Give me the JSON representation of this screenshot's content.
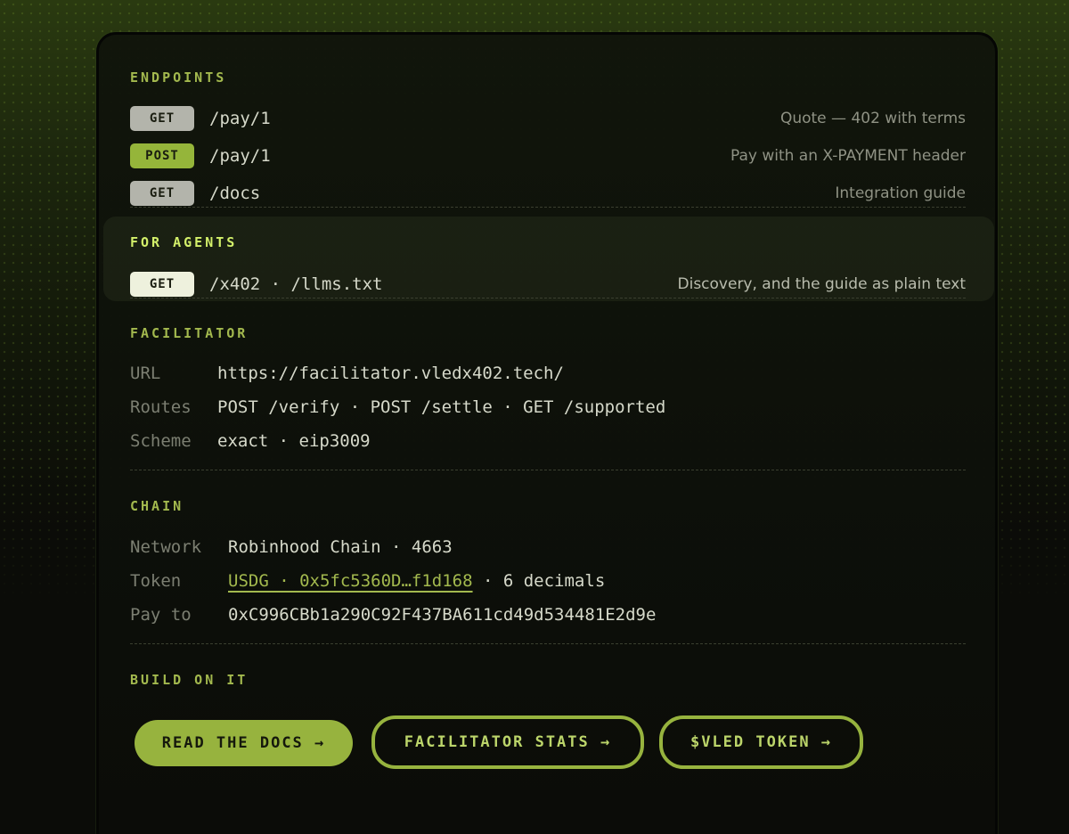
{
  "colors": {
    "accent": "#97b33e",
    "accent_bright": "#d3f06a",
    "background": "#0b0c08",
    "get_badge": "#b3b4ab",
    "post_badge": "#95b53a"
  },
  "endpoints": {
    "title": "ENDPOINTS",
    "rows": [
      {
        "method": "GET",
        "path": "/pay/1",
        "description": "Quote — 402 with terms"
      },
      {
        "method": "POST",
        "path": "/pay/1",
        "description": "Pay with an X-PAYMENT header"
      },
      {
        "method": "GET",
        "path": "/docs",
        "description": "Integration guide"
      }
    ]
  },
  "agents": {
    "title": "FOR AGENTS",
    "row": {
      "method": "GET",
      "path": "/x402 · /llms.txt",
      "description": "Discovery, and the guide as plain text"
    }
  },
  "facilitator": {
    "title": "FACILITATOR",
    "rows": [
      {
        "key": "URL",
        "value": "https://facilitator.vledx402.tech/"
      },
      {
        "key": "Routes",
        "value": "POST /verify · POST /settle · GET /supported"
      },
      {
        "key": "Scheme",
        "value": "exact · eip3009"
      }
    ]
  },
  "chain": {
    "title": "CHAIN",
    "network_key": "Network",
    "network_value": "Robinhood Chain · 4663",
    "token_key": "Token",
    "token_link": "USDG · 0x5fc5360D…f1d168",
    "token_suffix": " · 6 decimals",
    "payto_key": "Pay to",
    "payto_value": "0xC996CBb1a290C92F437BA611cd49d534481E2d9e"
  },
  "build": {
    "title": "BUILD ON IT",
    "buttons": [
      {
        "label": "READ THE DOCS →"
      },
      {
        "label": "FACILITATOR STATS →"
      },
      {
        "label": "$VLED TOKEN →"
      }
    ]
  }
}
